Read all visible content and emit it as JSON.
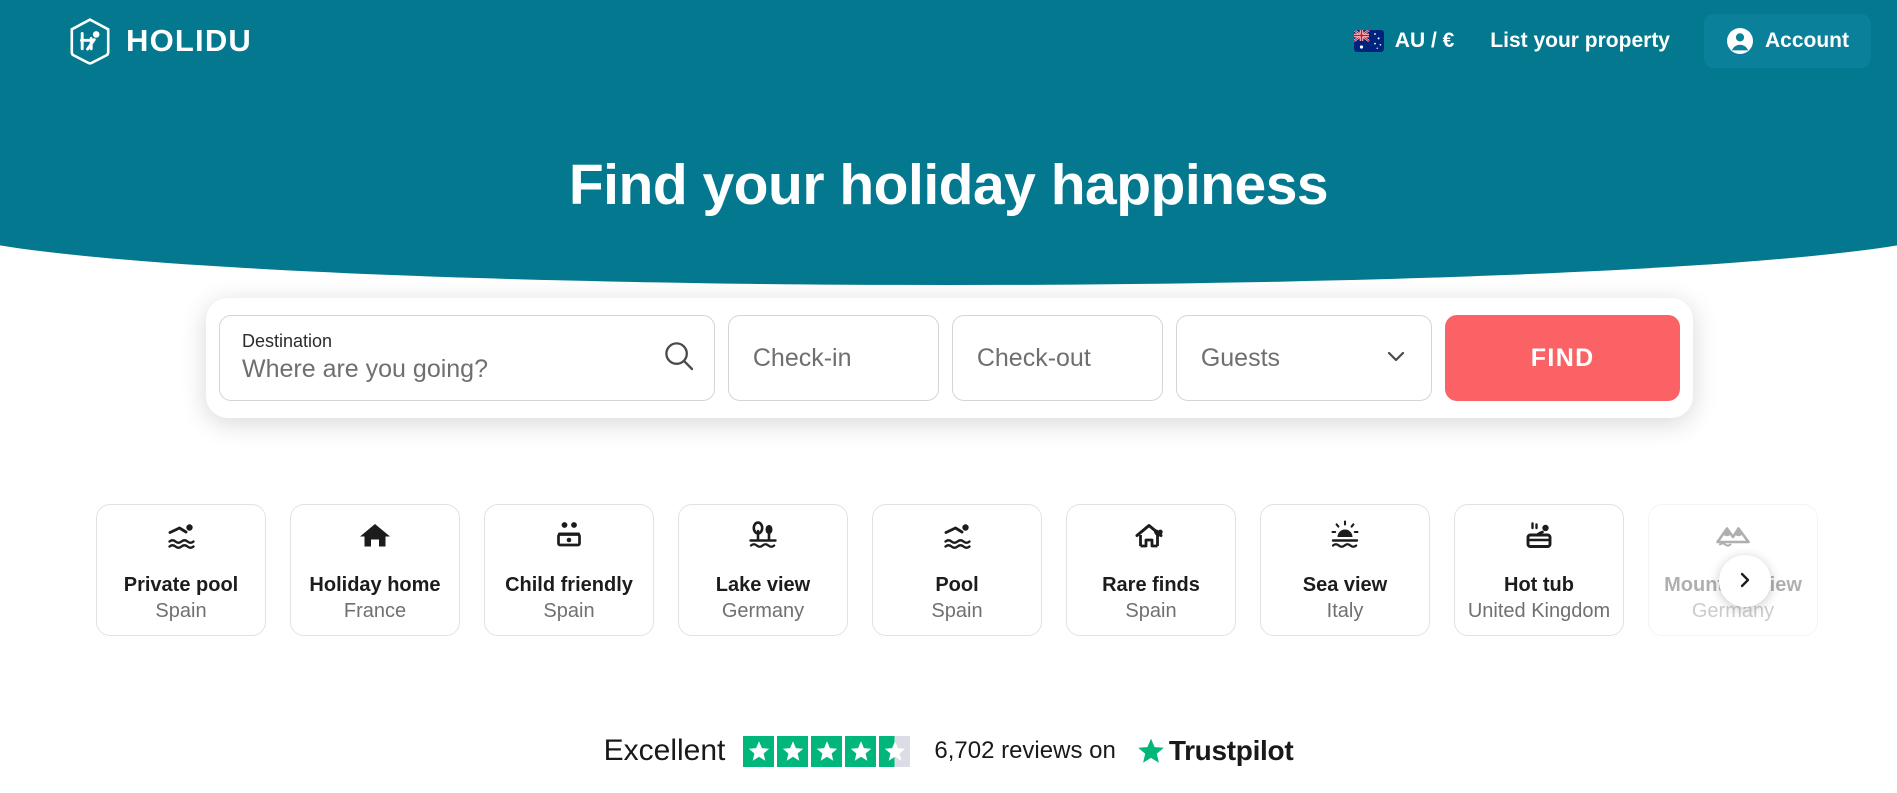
{
  "brand": {
    "name": "HOLIDU",
    "logo_icon": "holidu-house-logo"
  },
  "topnav": {
    "locale": {
      "label": "AU / €",
      "flag_icon": "australia-flag-icon"
    },
    "list_property_label": "List your property",
    "account": {
      "label": "Account",
      "icon": "user-account-icon",
      "background": "#0A809A"
    }
  },
  "hero": {
    "title": "Find your holiday happiness",
    "background": "#03788F"
  },
  "search": {
    "destination": {
      "label": "Destination",
      "placeholder": "Where are you going?",
      "value": "",
      "icon": "search-icon"
    },
    "checkin": {
      "placeholder": "Check-in",
      "value": ""
    },
    "checkout": {
      "placeholder": "Check-out",
      "value": ""
    },
    "guests": {
      "placeholder": "Guests",
      "value": "",
      "icon": "chevron-down-icon"
    },
    "find_label": "FIND",
    "find_color": "#FB6265"
  },
  "categories": [
    {
      "title": "Private pool",
      "country": "Spain",
      "icon": "swimmer-icon"
    },
    {
      "title": "Holiday home",
      "country": "France",
      "icon": "house-icon"
    },
    {
      "title": "Child friendly",
      "country": "Spain",
      "icon": "family-icon"
    },
    {
      "title": "Lake view",
      "country": "Germany",
      "icon": "lake-trees-icon"
    },
    {
      "title": "Pool",
      "country": "Spain",
      "icon": "swimmer-icon"
    },
    {
      "title": "Rare finds",
      "country": "Spain",
      "icon": "house-heart-icon"
    },
    {
      "title": "Sea view",
      "country": "Italy",
      "icon": "sunset-sea-icon"
    },
    {
      "title": "Hot tub",
      "country": "United Kingdom",
      "icon": "hot-tub-icon"
    },
    {
      "title": "Mountain view",
      "country": "Germany",
      "icon": "mountains-icon"
    }
  ],
  "carousel": {
    "next_label": "›",
    "next_icon": "chevron-right-icon"
  },
  "trustpilot": {
    "rating_word": "Excellent",
    "stars_filled": 4,
    "stars_half": 1,
    "stars_total": 5,
    "reviews_text": "6,702 reviews on",
    "brand_name": "Trustpilot",
    "star_color": "#00B67A"
  }
}
